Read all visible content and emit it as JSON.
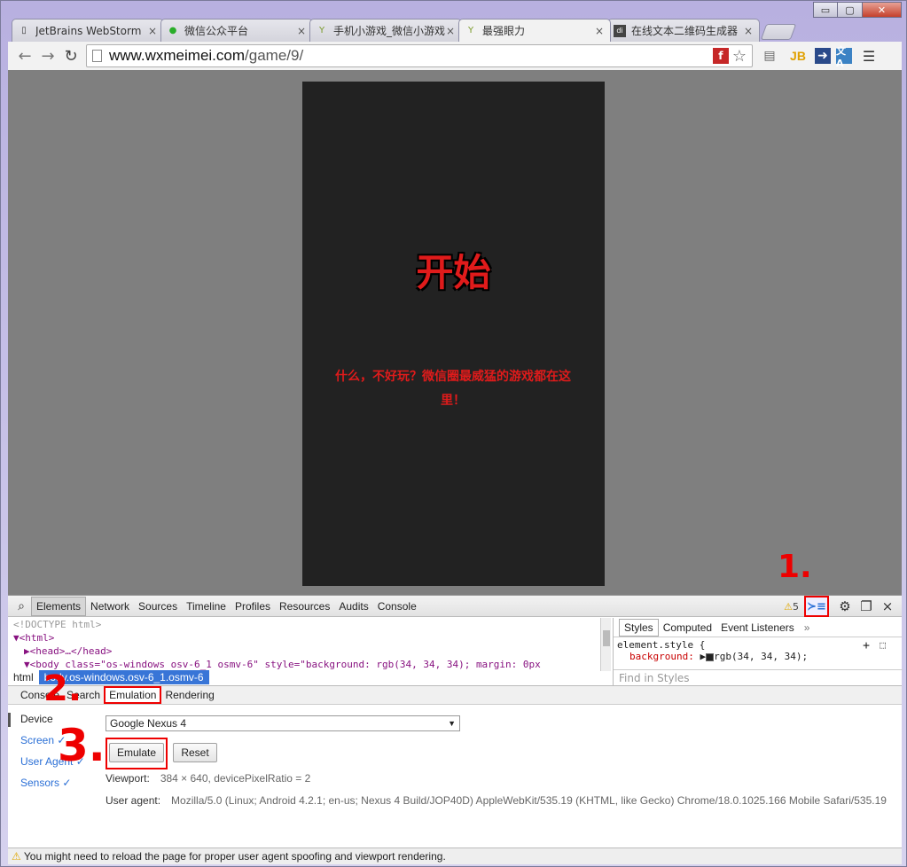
{
  "window_controls": {
    "minimize": "▭",
    "maximize": "▢",
    "close": "✕"
  },
  "tabs": [
    {
      "label": "JetBrains WebStorm",
      "icon": "page-icon"
    },
    {
      "label": "微信公众平台",
      "icon": "wechat-icon"
    },
    {
      "label": "手机小游戏_微信小游戏",
      "icon": "cocktail-icon"
    },
    {
      "label": "最强眼力",
      "icon": "cocktail-icon",
      "active": true
    },
    {
      "label": "在线文本二维码生成器",
      "icon": "qr-icon"
    }
  ],
  "toolbar": {
    "url_host": "www.wxmeimei.com",
    "url_path": "/game/9/"
  },
  "game": {
    "title": "开始",
    "subtitle": "什么，不好玩？微信圈最威猛的游戏都在这里！"
  },
  "devtools": {
    "panels": [
      "Elements",
      "Network",
      "Sources",
      "Timeline",
      "Profiles",
      "Resources",
      "Audits",
      "Console"
    ],
    "warning_count": "5",
    "elements_lines": [
      "<!DOCTYPE html>",
      "<html>",
      "<head>…</head>",
      "<body class=\"os-windows osv-6_1 osmv-6\" style=\"background: rgb(34, 34, 34); margin: 0px"
    ],
    "breadcrumb": [
      "html",
      "body.os-windows.osv-6_1.osmv-6"
    ],
    "styles_tabs": [
      "Styles",
      "Computed",
      "Event Listeners"
    ],
    "styles_more": "»",
    "element_style_selector": "element.style {",
    "element_style_prop": "background:",
    "element_style_value": "rgb(34, 34, 34);",
    "find_placeholder": "Find in Styles",
    "drawer_tabs": [
      "Console",
      "Search",
      "Emulation",
      "Rendering"
    ],
    "emulation": {
      "sidebar": [
        "Device",
        "Screen ✓",
        "User Agent ✓",
        "Sensors ✓"
      ],
      "device_selected": "Google Nexus 4",
      "emulate_label": "Emulate",
      "reset_label": "Reset",
      "viewport_label": "Viewport:",
      "viewport_value": "384 × 640, devicePixelRatio = 2",
      "ua_label": "User agent:",
      "ua_value": "Mozilla/5.0 (Linux; Android 4.2.1; en-us; Nexus 4 Build/JOP40D) AppleWebKit/535.19 (KHTML, like Gecko) Chrome/18.0.1025.166 Mobile Safari/535.19"
    },
    "status": "You might need to reload the page for proper user agent spoofing and viewport rendering."
  },
  "annotations": [
    "1.",
    "2.",
    "3."
  ],
  "colors": {
    "accent_red": "#e00000",
    "game_bg": "#222222",
    "page_bg": "#7f7f7f",
    "selection_blue": "#3875d7"
  }
}
